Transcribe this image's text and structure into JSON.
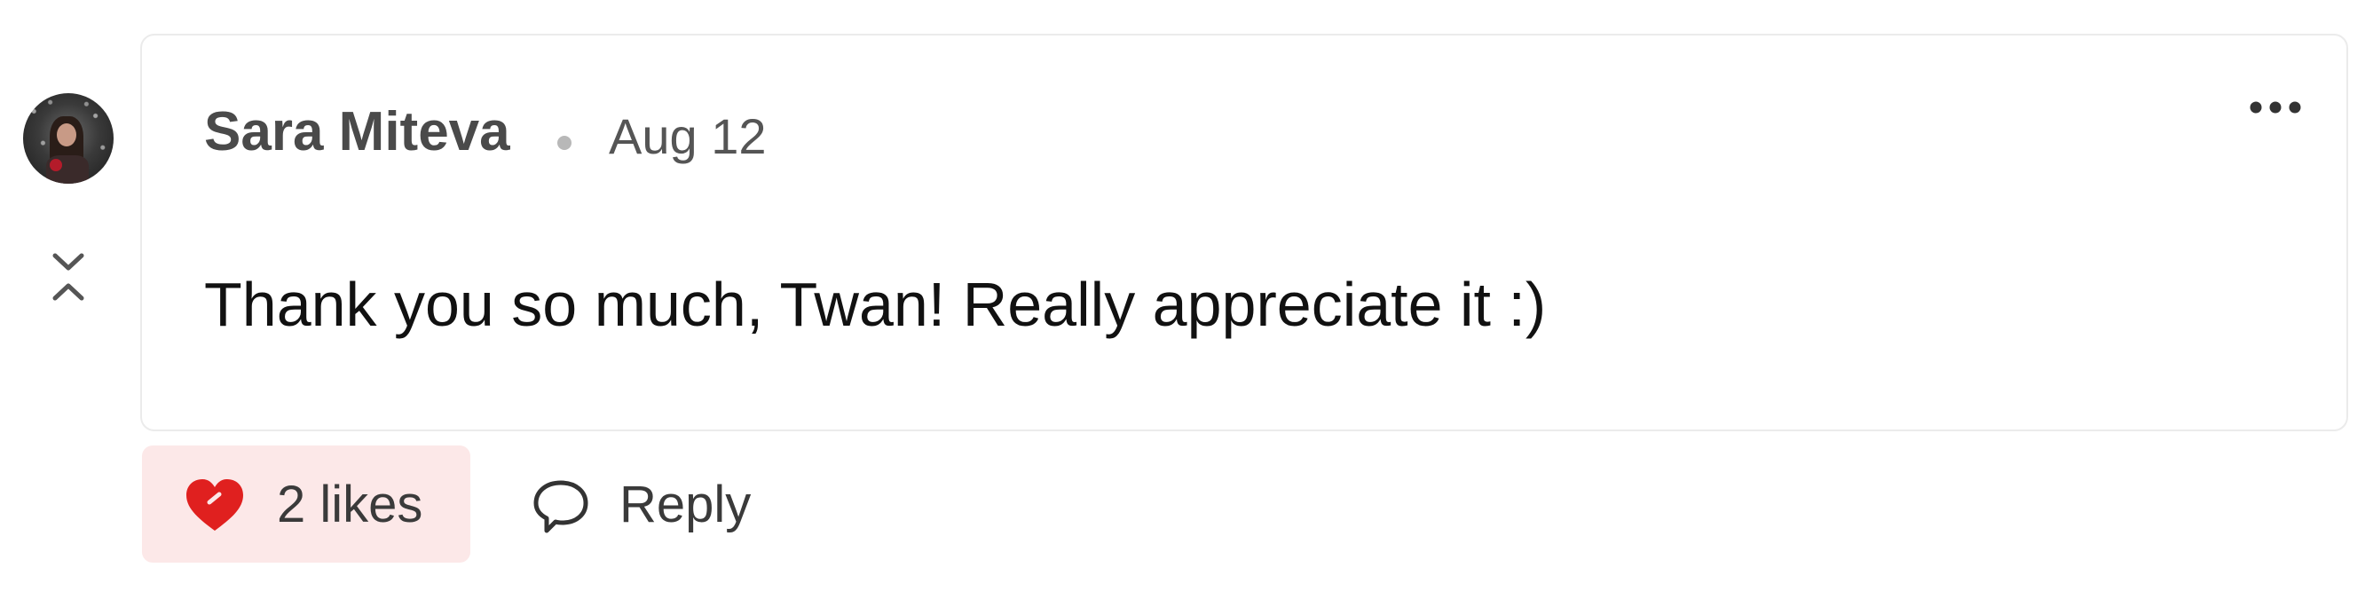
{
  "comment": {
    "author": "Sara Miteva",
    "date": "Aug 12",
    "text": "Thank you so much, Twan! Really appreciate it :)"
  },
  "actions": {
    "likes_label": "2 likes",
    "likes_count": 2,
    "liked": true,
    "reply_label": "Reply"
  },
  "icons": {
    "avatar": "avatar",
    "collapse": "collapse-icon",
    "more": "more-horizontal-icon",
    "like": "heart-icon",
    "reply": "speech-bubble-icon"
  },
  "colors": {
    "like_accent": "#e0201f",
    "like_background": "#fce8e8",
    "card_border": "#ebebeb",
    "author_text": "#4a4a4a"
  }
}
